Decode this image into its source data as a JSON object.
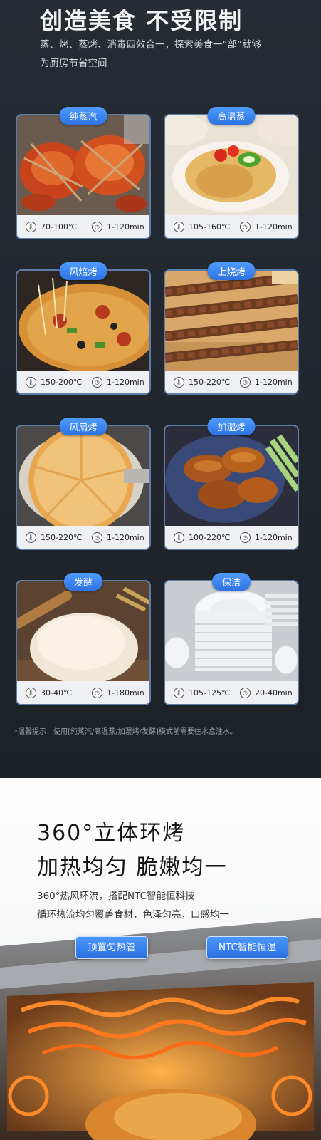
{
  "header": {
    "title": "创造美食 不受限制",
    "line1": "蒸、烤、蒸烤、消毒四效合一，探索美食一“部”就够",
    "line2": "为厨房节省空间"
  },
  "modes": [
    {
      "name": "纯蒸汽",
      "temp": "70-100℃",
      "time": "1-120min"
    },
    {
      "name": "高温蒸",
      "temp": "105-160℃",
      "time": "1-120min"
    },
    {
      "name": "风焙烤",
      "temp": "150-200℃",
      "time": "1-120min"
    },
    {
      "name": "上烧烤",
      "temp": "150-220℃",
      "time": "1-120min"
    },
    {
      "name": "风扇烤",
      "temp": "150-220℃",
      "time": "1-120min"
    },
    {
      "name": "加湿烤",
      "temp": "100-220℃",
      "time": "1-120min"
    },
    {
      "name": "发酵",
      "temp": "30-40℃",
      "time": "1-180min"
    },
    {
      "name": "保洁",
      "temp": "105-125℃",
      "time": "20-40min"
    }
  ],
  "tip": "*温馨提示：使用[纯蒸汽/高温蒸/加湿烤/发酵]模式前需要往水盒注水。",
  "section2": {
    "heading1": "360°立体环烤",
    "heading2": "加热均匀 脆嫩均一",
    "para1": "360°热风环流，搭配NTC智能恒科技",
    "para2": "循环热流均匀覆盖食材，色泽匀亮，口感均一",
    "label_left": "顶置匀热管",
    "label_right": "NTC智能恒温"
  },
  "icons": {
    "temp": "thermometer-icon",
    "time": "clock-icon"
  },
  "colors": {
    "accent": "#2d72e0",
    "card_border": "#5b7da8",
    "background": "#1f2429"
  }
}
